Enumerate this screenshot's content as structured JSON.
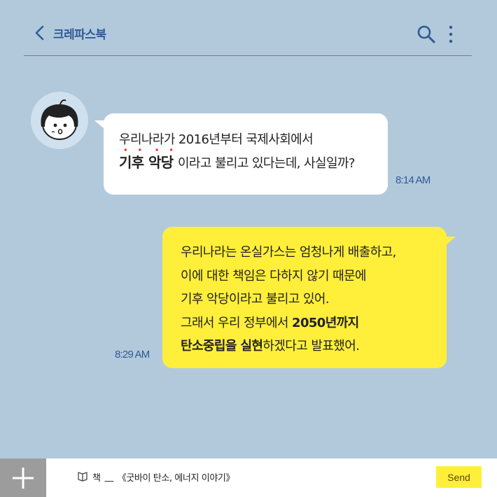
{
  "header": {
    "title": "크레파스북"
  },
  "messages": [
    {
      "sender": "other",
      "line1": "우리나라가 2016년부터 국제사회에서",
      "line2_emph": "기후 악당",
      "line2_rest": "이라고 불리고 있다는데, 사실일까?",
      "time": "8:14 AM"
    },
    {
      "sender": "me",
      "line1": "우리나라는 온실가스는 엄청나게 배출하고,",
      "line2": "이에 대한 책임은 다하지 않기 때문에",
      "line3": "기후 악당이라고 불리고 있어.",
      "line4_pre": "그래서 우리 정부에서 ",
      "line4_bold": "2050년까지",
      "line5_bold": "탄소중립을 실현",
      "line5_rest": "하겠다고 발표했어.",
      "time": "8:29 AM"
    }
  ],
  "composer": {
    "prefix": "책",
    "sep": "__",
    "value": "《굿바이 탄소, 에너지 이야기》",
    "send_label": "Send"
  },
  "colors": {
    "background": "#b2c9db",
    "accent": "#2f5a96",
    "my_bubble": "#ffef3a",
    "other_bubble": "#ffffff"
  }
}
